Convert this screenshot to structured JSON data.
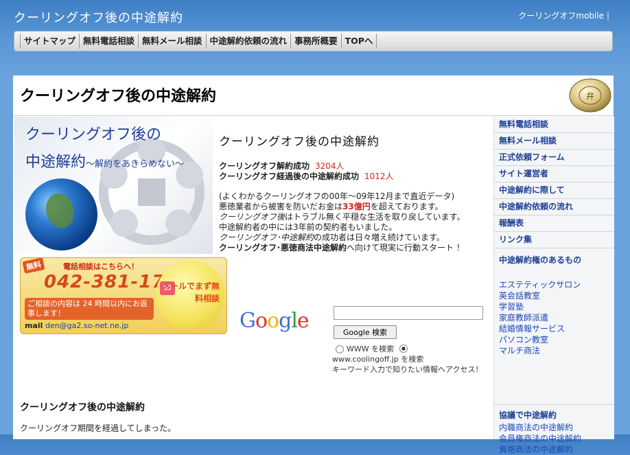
{
  "site": {
    "title": "クーリングオフ後の中途解約",
    "mobile_link": "クーリングオフmobile"
  },
  "topnav": [
    "サイトマップ",
    "無料電話相談",
    "無料メール相談",
    "中途解約依頼の流れ",
    "事務所概要",
    "TOPへ"
  ],
  "page": {
    "title": "クーリングオフ後の中途解約"
  },
  "banner": {
    "line1": "クーリングオフ後の",
    "line2": "中途解約",
    "line2_sub": "〜解約をあきらめない〜"
  },
  "contact": {
    "free_badge": "無料",
    "call_note": "電話相談はこちらへ！",
    "phone": "042-381-1779",
    "reply_note": "ご相談の内容は 24 時間以内にお返事します！",
    "mail_label": "mail",
    "mail_address": "den@ga2.so-net.ne.jp",
    "mail_button": "メールでまず無料相談"
  },
  "intro": {
    "heading": "クーリングオフ後の中途解約",
    "stat1_label": "クーリングオフ解約成功",
    "stat1_value": "3204人",
    "stat2_label": "クーリングオフ経過後の中途解約成功",
    "stat2_value": "1012人",
    "note1": "(よくわかるクーリングオフの00年〜09年12月まで直近データ)",
    "note2_pre": "悪徳業者から被害を防いだお金は",
    "note2_red": "33億円",
    "note2_post": "を超えております。",
    "note3_em": "クーリングオフ後",
    "note3_rest": "はトラブル無く平穏な生活を取り戻しています。",
    "note4": "中途解約者の中には3年前の契約者もいました。",
    "note5_em": "クーリングオフ･中途解約",
    "note5_rest": "の成功者は日々増え続けています。",
    "note6_bold": "クーリングオフ･悪徳商法中途解約",
    "note6_rest": "へ向けて現実に行動スタート ！"
  },
  "search": {
    "logo": "Google",
    "button": "Google 検索",
    "radio_www": "WWW を検索",
    "radio_site": "www.coolingoff.jp を検索",
    "desc": "キーワード入力で知りたい情報へアクセス！"
  },
  "section": {
    "title": "クーリングオフ後の中途解約",
    "text": "クーリングオフ期間を経過してしまった。"
  },
  "sidebar": {
    "items": [
      "無料電話相談",
      "無料メール相談",
      "正式依頼フォーム",
      "サイト運営者",
      "中途解約に際して",
      "中途解約依頼の流れ",
      "報酬表",
      "リンク集"
    ],
    "head1": "中途解約権のあるもの",
    "links1": [
      "エステティックサロン",
      "英会話教室",
      "学習塾",
      "家庭教師派遣",
      "結婚情報サービス",
      "パソコン教室",
      "マルチ商法"
    ],
    "head2": "協議で中途解約",
    "links2": [
      "内職商法の中途解約",
      "会員権商法の中途解約",
      "資格商法の中途解約"
    ]
  }
}
